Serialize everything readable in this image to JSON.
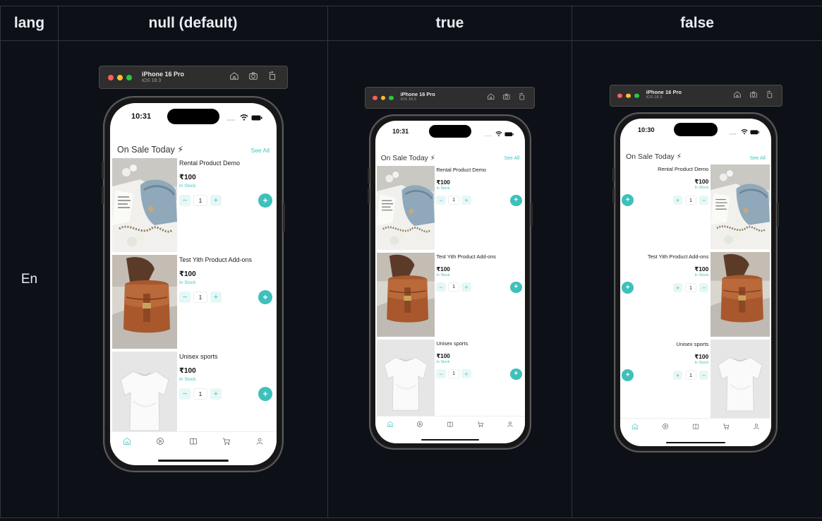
{
  "table": {
    "headers": [
      "lang",
      "null (default)",
      "true",
      "false"
    ],
    "row_label": "En"
  },
  "simulators": [
    {
      "device": "iPhone 16 Pro",
      "os": "iOS 18.3",
      "time": "10:31",
      "section_title": "On Sale Today ⚡",
      "see_all": "See All",
      "products": [
        {
          "name": "Rental Product Demo",
          "price": "₹100",
          "stock": "In Stock",
          "qty": "1",
          "image": "bag-blue"
        },
        {
          "name": "Test Yith Product Add-ons",
          "price": "₹100",
          "stock": "In Stock",
          "qty": "1",
          "image": "bag-brown"
        },
        {
          "name": "Unisex sports",
          "price": "₹100",
          "stock": "In Stock",
          "qty": "1",
          "image": "tshirt"
        }
      ],
      "nav": [
        "home-icon",
        "play-icon",
        "book-icon",
        "cart-icon",
        "user-icon"
      ]
    },
    {
      "device": "iPhone 16 Pro",
      "os": "iOS 18.3",
      "time": "10:31",
      "section_title": "On Sale Today ⚡",
      "see_all": "See All",
      "products": [
        {
          "name": "Rental Product Demo",
          "price": "₹100",
          "stock": "In Stock",
          "qty": "1",
          "image": "bag-blue"
        },
        {
          "name": "Test Yith Product Add-ons",
          "price": "₹100",
          "stock": "In Stock",
          "qty": "1",
          "image": "bag-brown"
        },
        {
          "name": "Unisex sports",
          "price": "₹100",
          "stock": "In Stock",
          "qty": "1",
          "image": "tshirt"
        }
      ],
      "nav": [
        "home-icon",
        "play-icon",
        "book-icon",
        "cart-icon",
        "user-icon"
      ]
    },
    {
      "device": "iPhone 16 Pro",
      "os": "iOS 18.3",
      "time": "10:30",
      "section_title": "On Sale Today ⚡",
      "see_all": "See All",
      "products": [
        {
          "name": "Rental Product Demo",
          "price": "₹100",
          "stock": "In Stock",
          "qty": "1",
          "image": "bag-blue"
        },
        {
          "name": "Test Yith Product Add-ons",
          "price": "₹100",
          "stock": "In Stock",
          "qty": "1",
          "image": "bag-brown"
        },
        {
          "name": "Unisex sports",
          "price": "₹100",
          "stock": "In Stock",
          "qty": "1",
          "image": "tshirt"
        }
      ],
      "nav": [
        "home-icon",
        "play-icon",
        "book-icon",
        "cart-icon",
        "user-icon"
      ]
    }
  ],
  "colors": {
    "accent": "#40c4c0",
    "background": "#0d1117",
    "border": "#30363d"
  }
}
